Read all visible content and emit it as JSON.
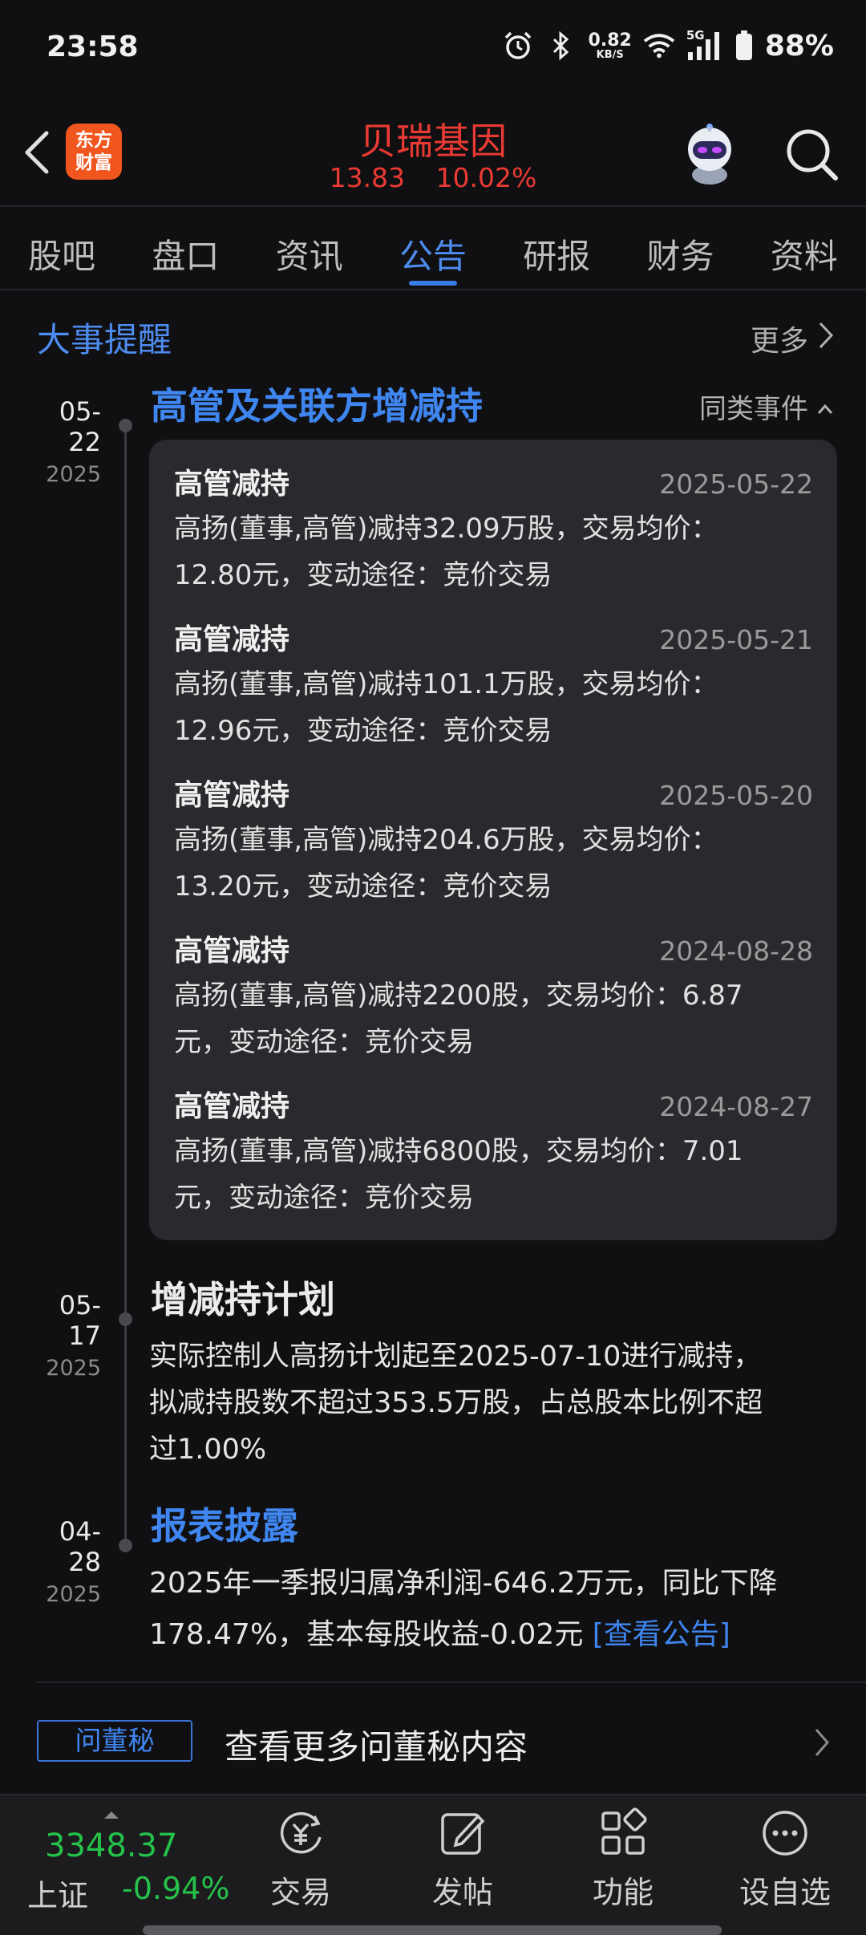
{
  "status_bar": {
    "time": "23:58",
    "net_speed_value": "0.82",
    "net_speed_unit": "KB/S",
    "network": "5G",
    "battery": "88%"
  },
  "header": {
    "logo_line1": "东方",
    "logo_line2": "财富",
    "stock_name": "贝瑞基因",
    "price": "13.83",
    "change_pct": "10.02%",
    "up_color": "#ea3a33"
  },
  "tabs": [
    {
      "label": "股吧",
      "active": false
    },
    {
      "label": "盘口",
      "active": false
    },
    {
      "label": "资讯",
      "active": false
    },
    {
      "label": "公告",
      "active": true
    },
    {
      "label": "研报",
      "active": false
    },
    {
      "label": "财务",
      "active": false
    },
    {
      "label": "资料",
      "active": false
    }
  ],
  "section": {
    "title": "大事提醒",
    "more": "更多"
  },
  "events": [
    {
      "date_md": "05-22",
      "date_year": "2025",
      "title": "高管及关联方增减持",
      "similar": "同类事件",
      "items": [
        {
          "title": "高管减持",
          "date": "2025-05-22",
          "line1": "高扬(董事,高管)减持32.09万股，交易均价：",
          "line2": "12.80元，变动途径：竞价交易"
        },
        {
          "title": "高管减持",
          "date": "2025-05-21",
          "line1": "高扬(董事,高管)减持101.1万股，交易均价：",
          "line2": "12.96元，变动途径：竞价交易"
        },
        {
          "title": "高管减持",
          "date": "2025-05-20",
          "line1": "高扬(董事,高管)减持204.6万股，交易均价：",
          "line2": "13.20元，变动途径：竞价交易"
        },
        {
          "title": "高管减持",
          "date": "2024-08-28",
          "line1": "高扬(董事,高管)减持2200股，交易均价：6.87",
          "line2": "元，变动途径：竞价交易"
        },
        {
          "title": "高管减持",
          "date": "2024-08-27",
          "line1": "高扬(董事,高管)减持6800股，交易均价：7.01",
          "line2": "元，变动途径：竞价交易"
        }
      ]
    },
    {
      "date_md": "05-17",
      "date_year": "2025",
      "title": "增减持计划",
      "line1": "实际控制人高扬计划起至2025-07-10进行减持，",
      "line2": "拟减持股数不超过353.5万股，占总股本比例不超",
      "line3": "过1.00%"
    },
    {
      "date_md": "04-28",
      "date_year": "2025",
      "title": "报表披露",
      "line1": "2025年一季报归属净利润-646.2万元，同比下降",
      "line2": "178.47%，基本每股收益-0.02元 ",
      "link": "[查看公告]"
    }
  ],
  "ask": {
    "badge": "问董秘",
    "text": "查看更多问董秘内容"
  },
  "bottom_bar": {
    "index_value": "3348.37",
    "index_name": "上证",
    "index_change": "-0.94%",
    "down_color": "#25c24a",
    "items": [
      {
        "label": "交易",
        "icon": "trade-icon"
      },
      {
        "label": "发帖",
        "icon": "compose-icon"
      },
      {
        "label": "功能",
        "icon": "apps-icon"
      },
      {
        "label": "设自选",
        "icon": "more-icon"
      }
    ]
  }
}
